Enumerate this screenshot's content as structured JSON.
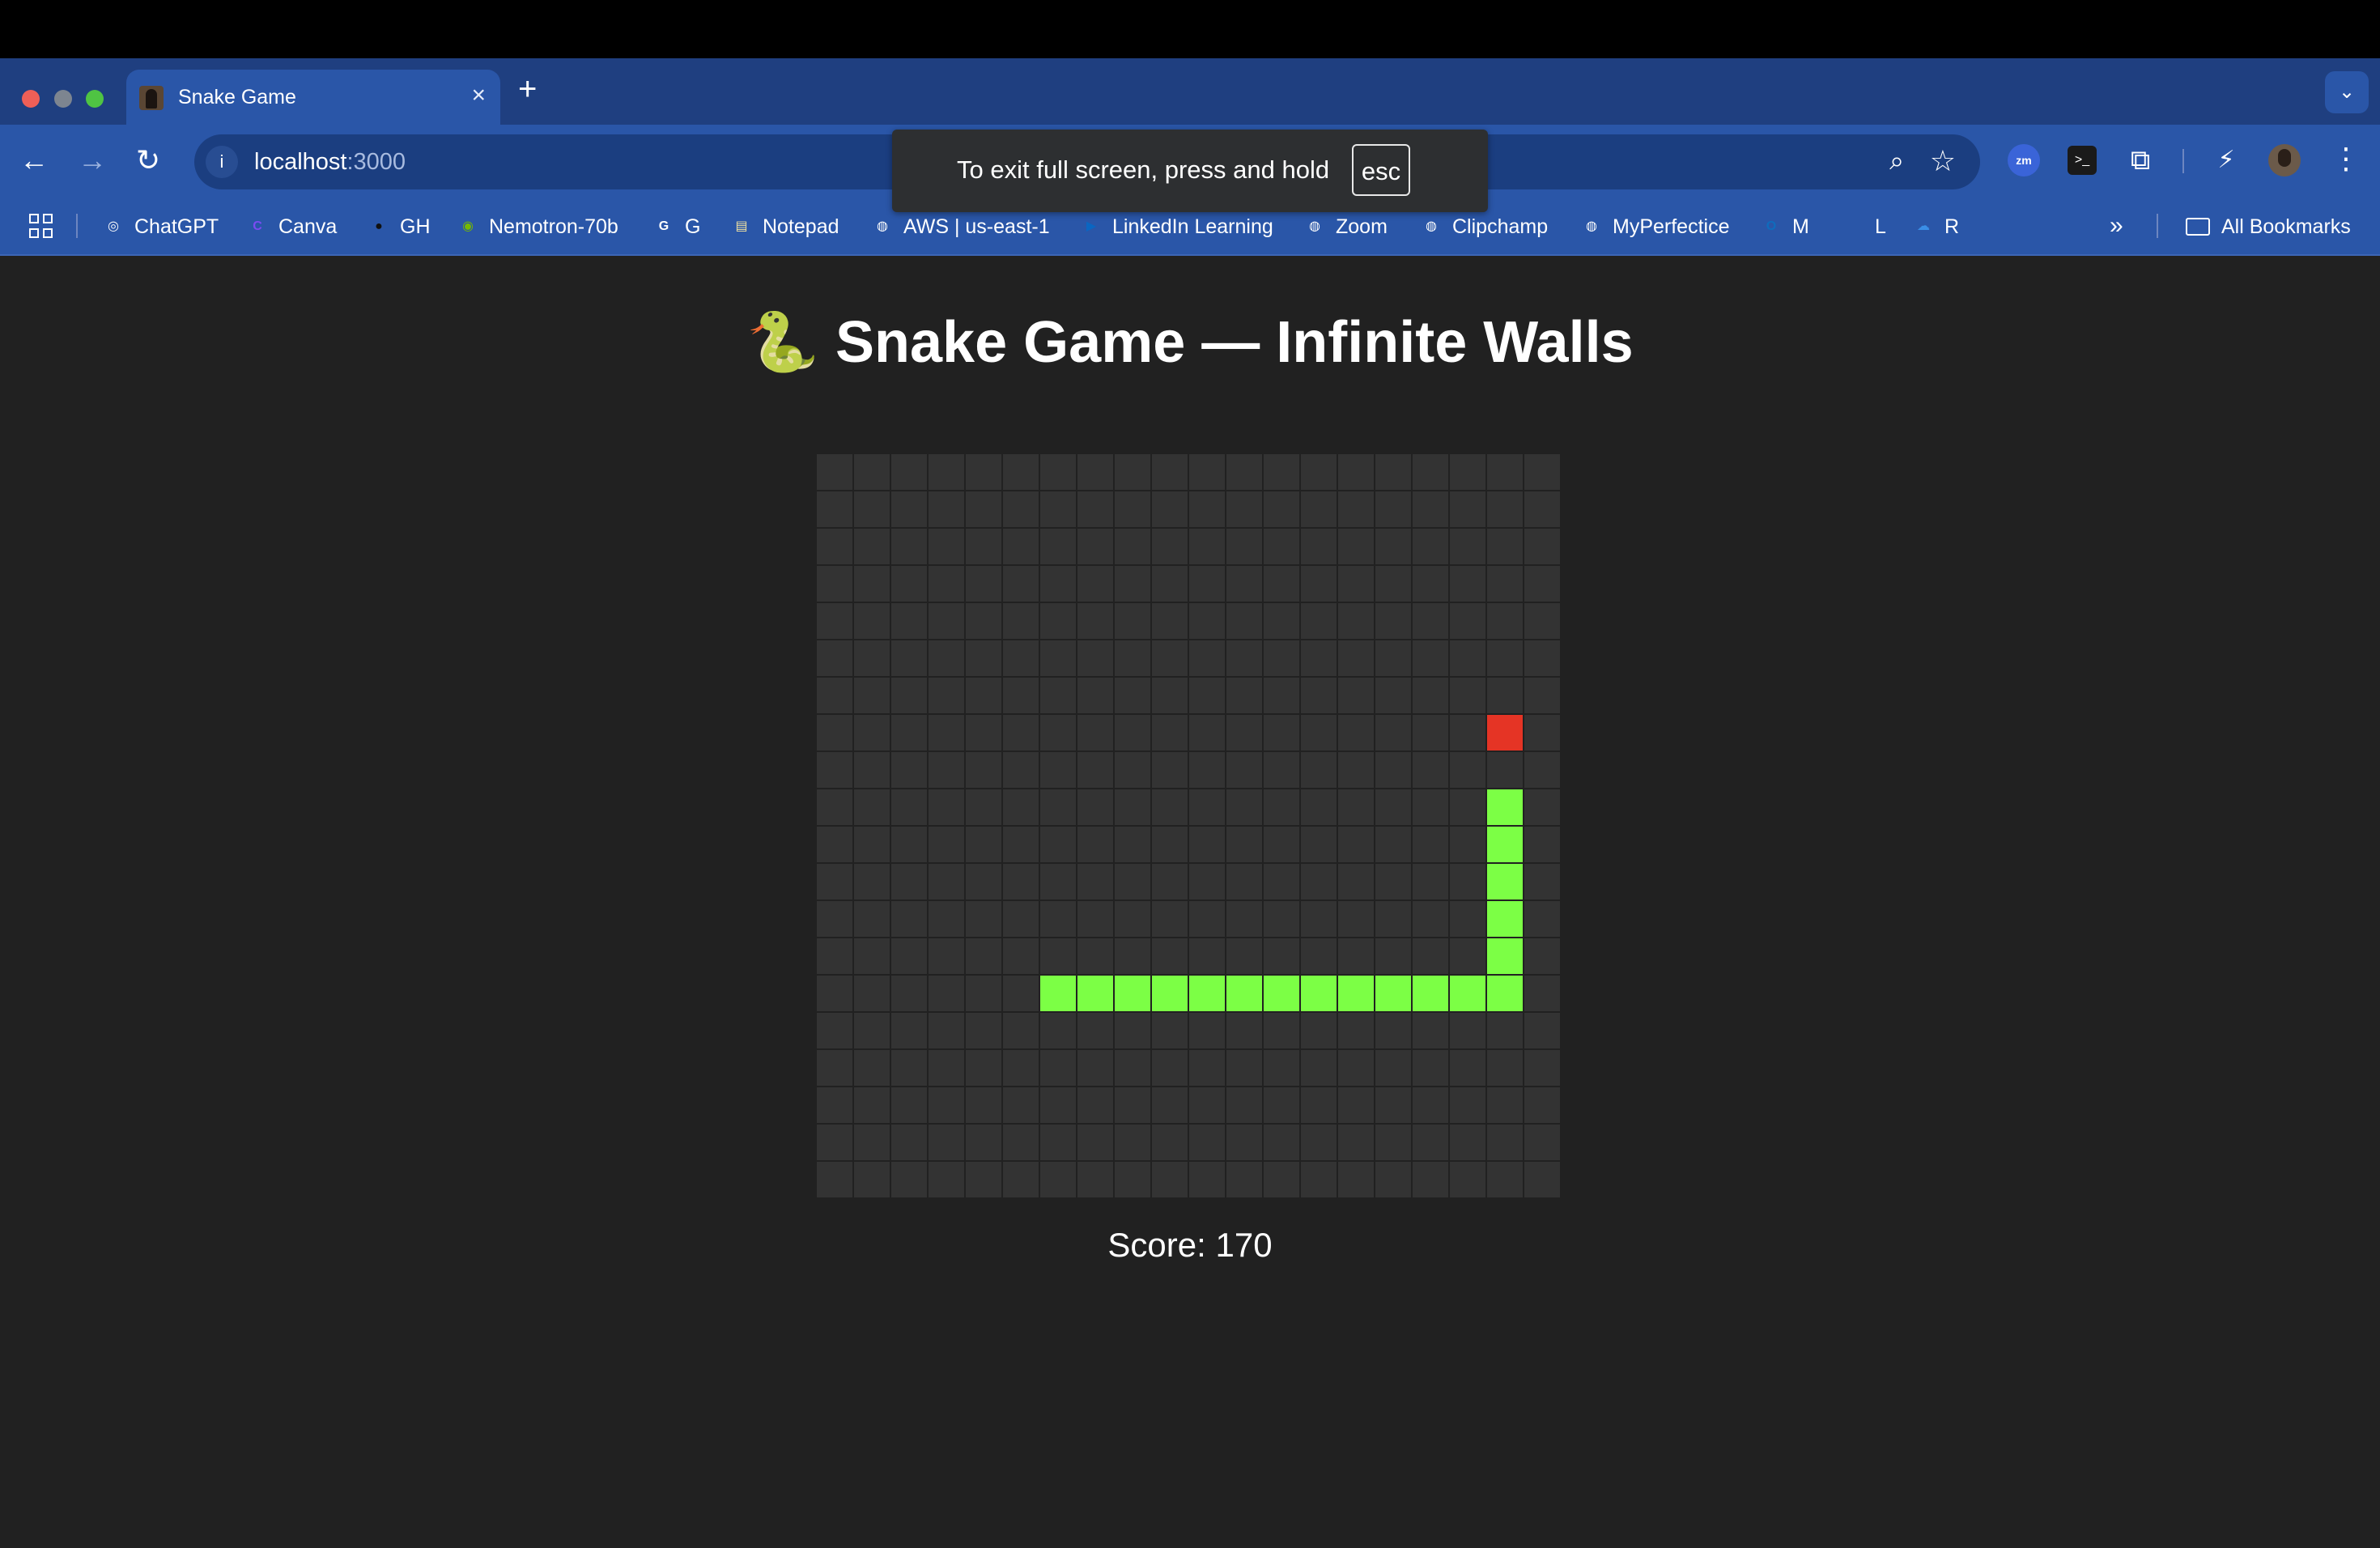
{
  "browser": {
    "tab": {
      "title": "Snake Game",
      "close": "×"
    },
    "new_tab": "+",
    "tab_search": "⌄",
    "nav": {
      "back": "←",
      "forward": "→",
      "reload": "↻"
    },
    "url": {
      "host": "localhost",
      "port": ":3000"
    },
    "bookmarks": [
      {
        "label": "ChatGPT",
        "icon": "chatgpt-icon",
        "glyph": "◎",
        "color": "#ffffff"
      },
      {
        "label": "Canva",
        "icon": "canva-icon",
        "glyph": "C",
        "color": "#7b4bf2"
      },
      {
        "label": "GH",
        "icon": "github-icon",
        "glyph": "●",
        "color": "#111111"
      },
      {
        "label": "Nemotron-70b",
        "icon": "nvidia-icon",
        "glyph": "◉",
        "color": "#76b900"
      },
      {
        "label": "G",
        "icon": "google-icon",
        "glyph": "G",
        "color": "#ffffff"
      },
      {
        "label": "Notepad",
        "icon": "notepad-icon",
        "glyph": "▤",
        "color": "#f3e3a0"
      },
      {
        "label": "AWS | us-east-1",
        "icon": "globe-icon",
        "glyph": "◍",
        "color": "#ffffff"
      },
      {
        "label": "LinkedIn Learning",
        "icon": "linkedin-learning-icon",
        "glyph": "▶",
        "color": "#0a66c2"
      },
      {
        "label": "Zoom",
        "icon": "globe-icon",
        "glyph": "◍",
        "color": "#ffffff"
      },
      {
        "label": "Clipchamp",
        "icon": "globe-icon",
        "glyph": "◍",
        "color": "#ffffff"
      },
      {
        "label": "MyPerfectice",
        "icon": "globe-icon",
        "glyph": "◍",
        "color": "#ffffff"
      },
      {
        "label": "M",
        "icon": "outlook-icon",
        "glyph": "O",
        "color": "#0f6cbd"
      },
      {
        "label": "L",
        "icon": "linkedin-icon",
        "glyph": "in",
        "color": "#2a56a8"
      },
      {
        "label": "R",
        "icon": "onedrive-icon",
        "glyph": "☁",
        "color": "#3a8ee6"
      }
    ],
    "bookmarks_more": "»",
    "all_bookmarks": "All Bookmarks"
  },
  "fullscreen_toast": {
    "message": "To exit full screen, press and hold",
    "key": "esc"
  },
  "page": {
    "title": "🐍 Snake Game — Infinite Walls",
    "score_label": "Score: 170"
  },
  "game": {
    "grid_cols": 20,
    "grid_rows": 20,
    "colors": {
      "empty": "#333333",
      "snake": "#7cff45",
      "food": "#e53425",
      "background": "#212121"
    },
    "food": [
      18,
      7
    ],
    "snake": [
      [
        18,
        9
      ],
      [
        18,
        10
      ],
      [
        18,
        11
      ],
      [
        18,
        12
      ],
      [
        18,
        13
      ],
      [
        18,
        14
      ],
      [
        17,
        14
      ],
      [
        16,
        14
      ],
      [
        15,
        14
      ],
      [
        14,
        14
      ],
      [
        13,
        14
      ],
      [
        12,
        14
      ],
      [
        11,
        14
      ],
      [
        10,
        14
      ],
      [
        9,
        14
      ],
      [
        8,
        14
      ],
      [
        7,
        14
      ],
      [
        6,
        14
      ]
    ],
    "score": 170
  }
}
